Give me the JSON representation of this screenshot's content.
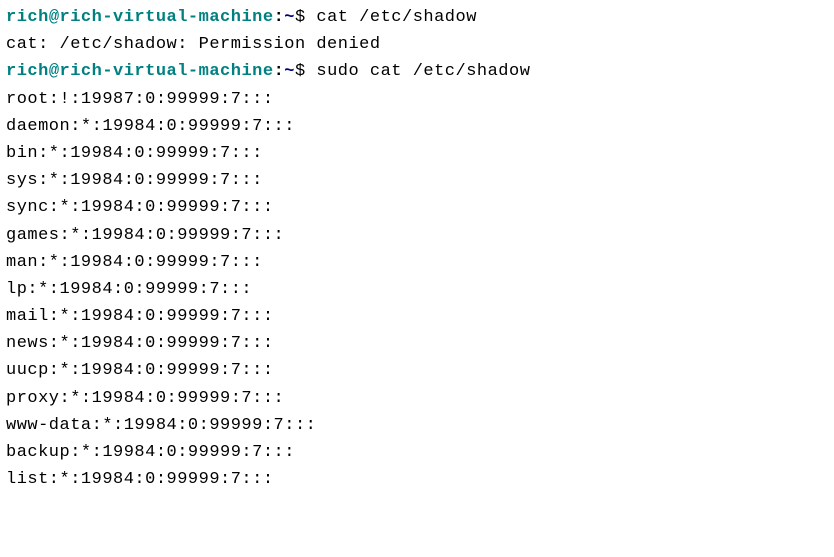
{
  "prompt": {
    "user": "rich",
    "at": "@",
    "host": "rich-virtual-machine",
    "colon": ":",
    "path": "~",
    "dollar": "$ "
  },
  "commands": {
    "cmd1": "cat /etc/shadow",
    "cmd2": "sudo cat /etc/shadow"
  },
  "output": {
    "denied": "cat: /etc/shadow: Permission denied",
    "lines": [
      "root:!:19987:0:99999:7:::",
      "daemon:*:19984:0:99999:7:::",
      "bin:*:19984:0:99999:7:::",
      "sys:*:19984:0:99999:7:::",
      "sync:*:19984:0:99999:7:::",
      "games:*:19984:0:99999:7:::",
      "man:*:19984:0:99999:7:::",
      "lp:*:19984:0:99999:7:::",
      "mail:*:19984:0:99999:7:::",
      "news:*:19984:0:99999:7:::",
      "uucp:*:19984:0:99999:7:::",
      "proxy:*:19984:0:99999:7:::",
      "www-data:*:19984:0:99999:7:::",
      "backup:*:19984:0:99999:7:::",
      "list:*:19984:0:99999:7:::"
    ]
  }
}
